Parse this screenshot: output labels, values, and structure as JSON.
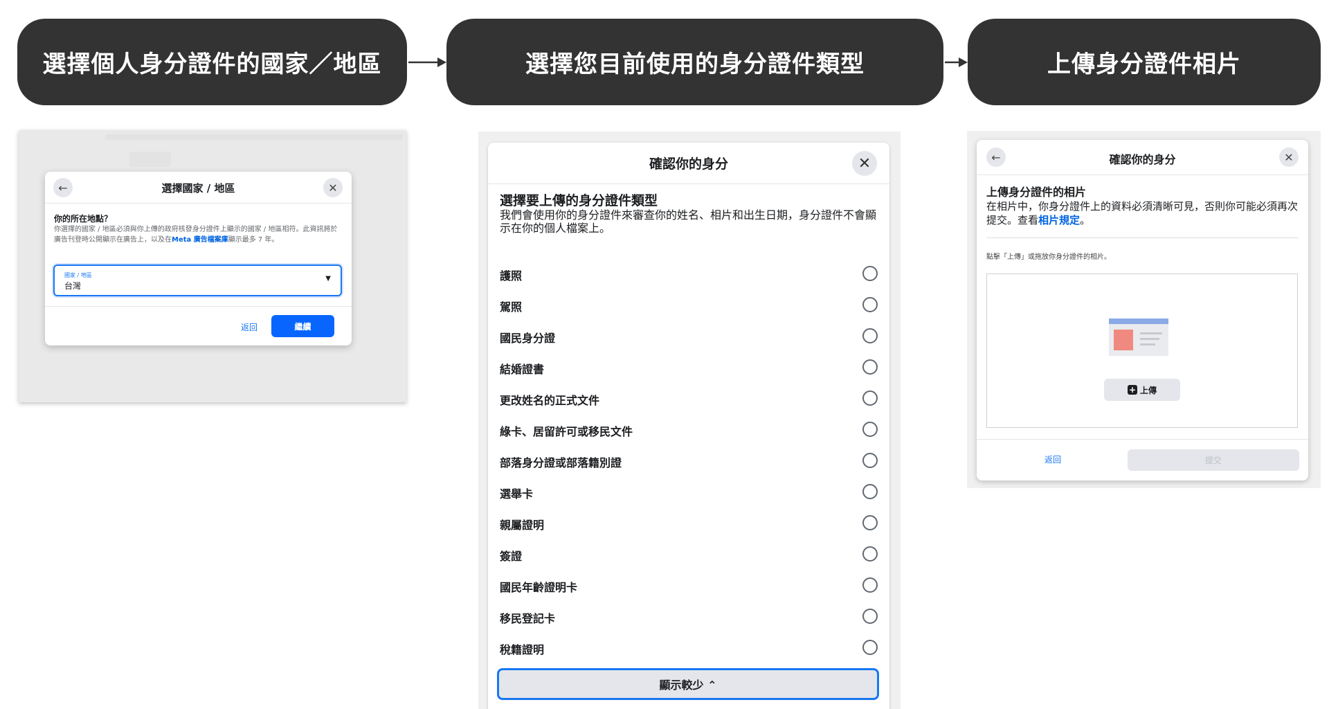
{
  "steps": [
    {
      "label": "選擇個人身分證件的國家／地區"
    },
    {
      "label": "選擇您目前使用的身分證件類型"
    },
    {
      "label": "上傳身分證件相片"
    }
  ],
  "panel1": {
    "title": "選擇國家 / 地區",
    "question": "你的所在地點？",
    "description_before": "你選擇的國家 / 地區必須與你上傳的政府核發身分證件上顯示的國家 / 地區相符。此資訊將於廣告刊登時公開顯示在廣告上，以及在",
    "description_link": "Meta 廣告檔案庫",
    "description_after": "顯示最多 7 年。",
    "field_label": "國家 / 地區",
    "field_value": "台灣",
    "back_label": "返回",
    "continue_label": "繼續",
    "back_icon": "←",
    "close_icon": "✕",
    "caret_icon": "▼"
  },
  "panel2": {
    "title": "確認你的身分",
    "subtitle": "選擇要上傳的身分證件類型",
    "description": "我們會使用你的身分證件來審查你的姓名、相片和出生日期，身分證件不會顯示在你的個人檔案上。",
    "options": [
      {
        "label": "護照"
      },
      {
        "label": "駕照"
      },
      {
        "label": "國民身分證"
      },
      {
        "label": "結婚證書"
      },
      {
        "label": "更改姓名的正式文件"
      },
      {
        "label": "綠卡、居留許可或移民文件"
      },
      {
        "label": "部落身分證或部落籍別證"
      },
      {
        "label": "選舉卡"
      },
      {
        "label": "親屬證明"
      },
      {
        "label": "簽證"
      },
      {
        "label": "國民年齡證明卡"
      },
      {
        "label": "移民登記卡"
      },
      {
        "label": "稅籍證明"
      }
    ],
    "show_less_label": "顯示較少 ⌃",
    "close_icon": "✕"
  },
  "panel3": {
    "title": "確認你的身分",
    "subtitle": "上傳身分證件的相片",
    "description_before": "在相片中，你身分證件上的資料必須清晰可見，否則你可能必須再次提交。查看",
    "description_link": "相片規定",
    "description_after": "。",
    "hint": "點擊「上傳」或拖放你身分證件的相片。",
    "upload_label": "上傳",
    "back_label": "返回",
    "submit_label": "提交",
    "back_icon": "←",
    "close_icon": "✕",
    "plus_icon": "+"
  },
  "colors": {
    "step_bg": "#333333",
    "primary_blue": "#0866ff",
    "link_blue": "#1877f2"
  }
}
